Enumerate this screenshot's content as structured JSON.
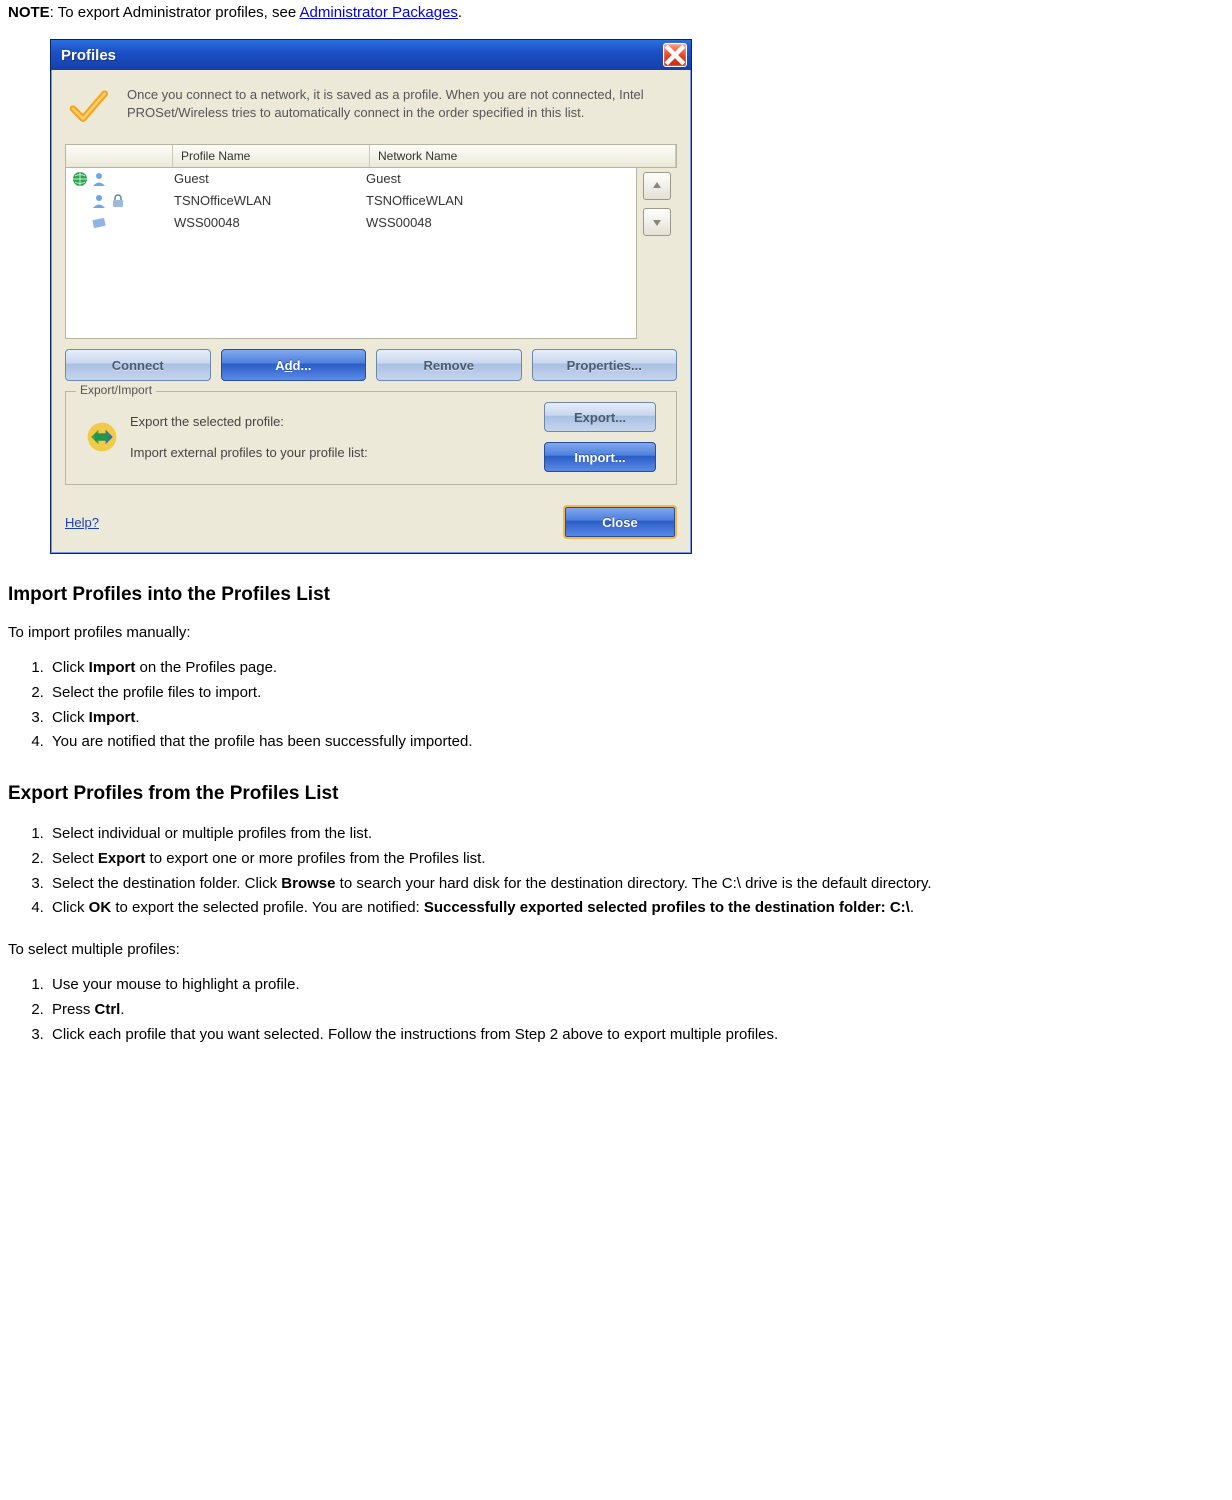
{
  "note": {
    "label": "NOTE",
    "text_before": ": To export Administrator profiles, see ",
    "link_text": "Administrator Packages",
    "text_after": "."
  },
  "dialog": {
    "title": "Profiles",
    "intro": "Once you connect to a network, it is saved as a profile. When you are not connected, Intel PROSet/Wireless tries to automatically connect in the order specified in this list.",
    "columns": {
      "profile": "Profile Name",
      "network": "Network Name"
    },
    "rows": [
      {
        "profile": "Guest",
        "network": "Guest"
      },
      {
        "profile": "TSNOfficeWLAN",
        "network": "TSNOfficeWLAN"
      },
      {
        "profile": "WSS00048",
        "network": "WSS00048"
      }
    ],
    "buttons": {
      "connect": "Connect",
      "add_prefix": "A",
      "add_ul": "d",
      "add_suffix": "d...",
      "remove": "Remove",
      "properties": "Properties..."
    },
    "ei": {
      "legend": "Export/Import",
      "export_text": "Export the selected profile:",
      "import_text": "Import external profiles to your profile list:",
      "export_prefix": "E",
      "export_ul": "x",
      "export_suffix": "port...",
      "import_prefix": "I",
      "import_ul": "m",
      "import_suffix": "port..."
    },
    "help": "Help?",
    "close": "Close"
  },
  "sections": {
    "import_title": "Import Profiles into the Profiles List",
    "import_intro": "To import profiles manually:",
    "import_steps": {
      "s1_a": "Click ",
      "s1_b": "Import",
      "s1_c": " on the Profiles page.",
      "s2": "Select the profile files to import.",
      "s3_a": "Click ",
      "s3_b": "Import",
      "s3_c": ".",
      "s4": "You are notified that the profile has been successfully imported."
    },
    "export_title": "Export Profiles from the Profiles List",
    "export_steps": {
      "s1": "Select individual or multiple profiles from the list.",
      "s2_a": "Select ",
      "s2_b": "Export",
      "s2_c": " to export one or more profiles from the Profiles list.",
      "s3_a": "Select the destination folder. Click ",
      "s3_b": "Browse",
      "s3_c": " to search your hard disk for the destination directory. The C:\\ drive is the default directory.",
      "s4_a": "Click ",
      "s4_b": "OK",
      "s4_c": " to export the selected profile. You are notified: ",
      "s4_d": "Successfully exported selected profiles to the destination folder: C:\\",
      "s4_e": "."
    },
    "multi_intro": "To select multiple profiles:",
    "multi_steps": {
      "s1": "Use your mouse to highlight a profile.",
      "s2_a": "Press ",
      "s2_b": "Ctrl",
      "s2_c": ".",
      "s3": "Click each profile that you want selected. Follow the instructions from Step 2 above to export multiple profiles."
    }
  }
}
